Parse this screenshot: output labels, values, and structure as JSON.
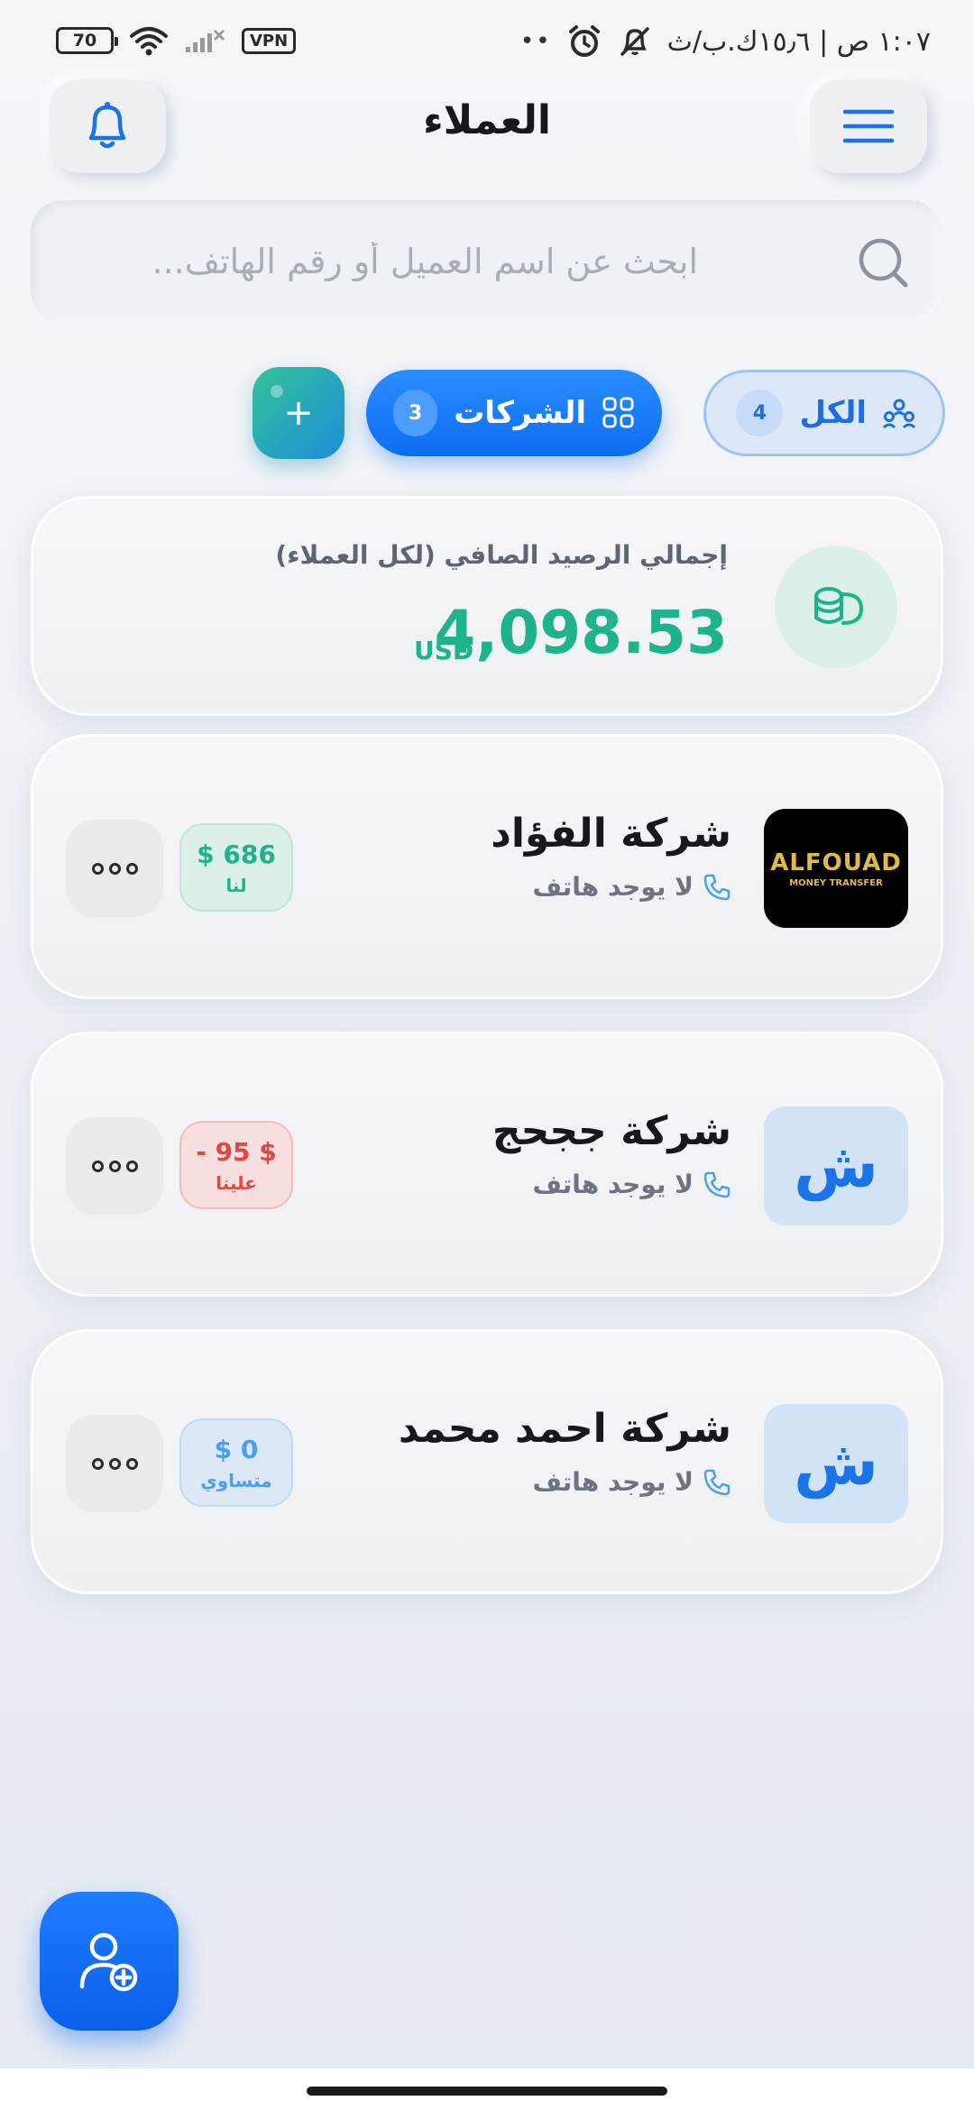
{
  "status_bar": {
    "time": "١:٠٧ ص | ١٥٫٦ك.ب/ث",
    "battery": "70",
    "vpn": "VPN",
    "dots": "••"
  },
  "header": {
    "title": "العملاء"
  },
  "search": {
    "placeholder": "ابحث عن اسم العميل أو رقم الهاتف..."
  },
  "filters": {
    "all": {
      "label": "الكل",
      "count": "4"
    },
    "companies": {
      "label": "الشركات",
      "count": "3"
    },
    "add": "+"
  },
  "summary": {
    "label": "إجمالي الرصيد الصافي (لكل العملاء)",
    "amount": "4,098.53",
    "currency": "USD"
  },
  "clients": [
    {
      "name": "شركة الفؤاد",
      "phone": "لا يوجد هاتف",
      "logo_text": "ALFOUAD",
      "logo_sub": "MONEY TRANSFER",
      "balance": "$ 686",
      "balance_note": "لنا",
      "status_color": "#1eb38a"
    },
    {
      "name": "شركة ججحج",
      "phone": "لا يوجد هاتف",
      "logo_letter": "ش",
      "balance": "- 95 $",
      "balance_note": "علينا",
      "status_color": "#e04848"
    },
    {
      "name": "شركة احمد محمد",
      "phone": "لا يوجد هاتف",
      "logo_letter": "ش",
      "balance": "$ 0",
      "balance_note": "متساوي",
      "status_color": "#4aa0ef"
    }
  ],
  "colors": {
    "primary": "#1a74e8",
    "positive": "#1eb38a",
    "negative": "#e04848",
    "neutral": "#4aa0ef"
  },
  "icons": [
    "bell-icon",
    "menu-icon",
    "search-icon",
    "people-icon",
    "grid-icon",
    "coins-icon",
    "phone-icon",
    "more-icon",
    "add-user-icon"
  ]
}
